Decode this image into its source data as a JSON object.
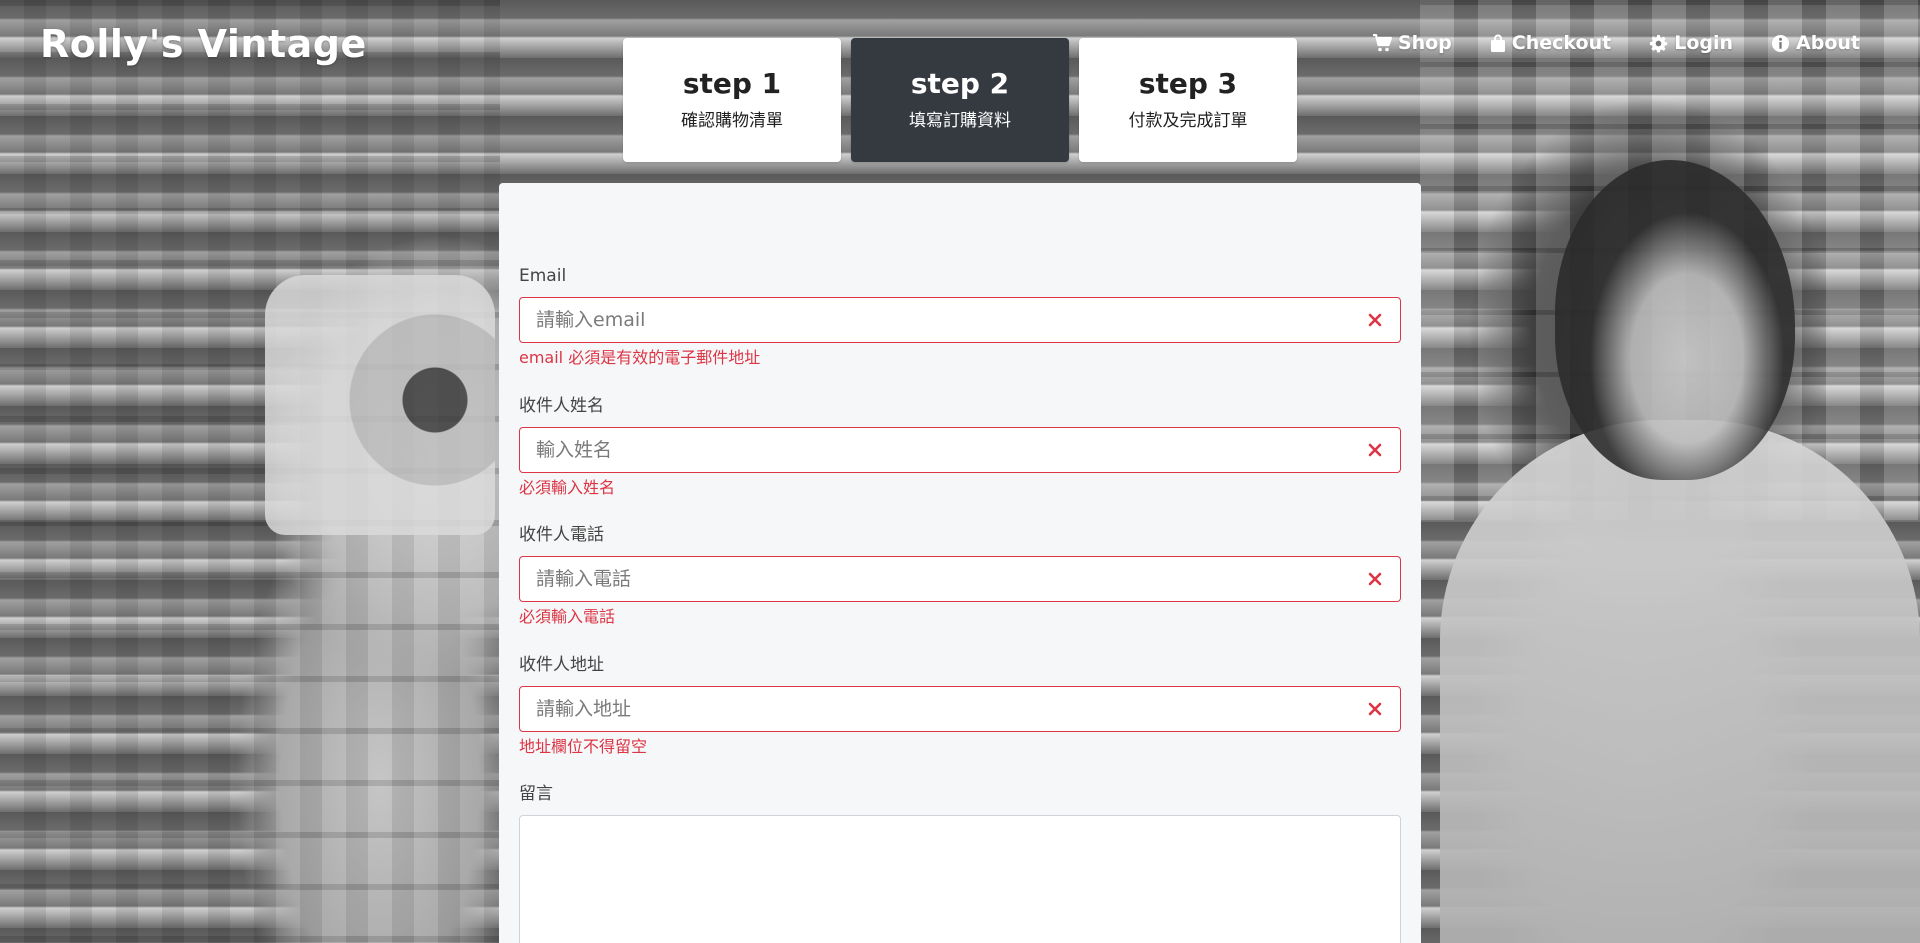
{
  "navbar": {
    "brand": "Rolly's Vintage",
    "links": [
      {
        "label": "Shop",
        "icon": "cart-icon"
      },
      {
        "label": "Checkout",
        "icon": "shopping-bag-icon"
      },
      {
        "label": "Login",
        "icon": "gear-icon"
      },
      {
        "label": "About",
        "icon": "info-icon"
      }
    ]
  },
  "steps": [
    {
      "title": "step 1",
      "subtitle": "確認購物清單",
      "active": false
    },
    {
      "title": "step 2",
      "subtitle": "填寫訂購資料",
      "active": true
    },
    {
      "title": "step 3",
      "subtitle": "付款及完成訂單",
      "active": false
    }
  ],
  "form": {
    "email": {
      "label": "Email",
      "placeholder": "請輸入email",
      "value": "",
      "error": "email 必須是有效的電子郵件地址"
    },
    "name": {
      "label": "收件人姓名",
      "placeholder": "輸入姓名",
      "value": "",
      "error": "必須輸入姓名"
    },
    "phone": {
      "label": "收件人電話",
      "placeholder": "請輸入電話",
      "value": "",
      "error": "必須輸入電話"
    },
    "address": {
      "label": "收件人地址",
      "placeholder": "請輸入地址",
      "value": "",
      "error": "地址欄位不得留空"
    },
    "message": {
      "label": "留言",
      "value": ""
    }
  },
  "colors": {
    "error": "#dc3545",
    "active_step_bg": "#343a40",
    "panel_bg": "#f6f7f8"
  }
}
